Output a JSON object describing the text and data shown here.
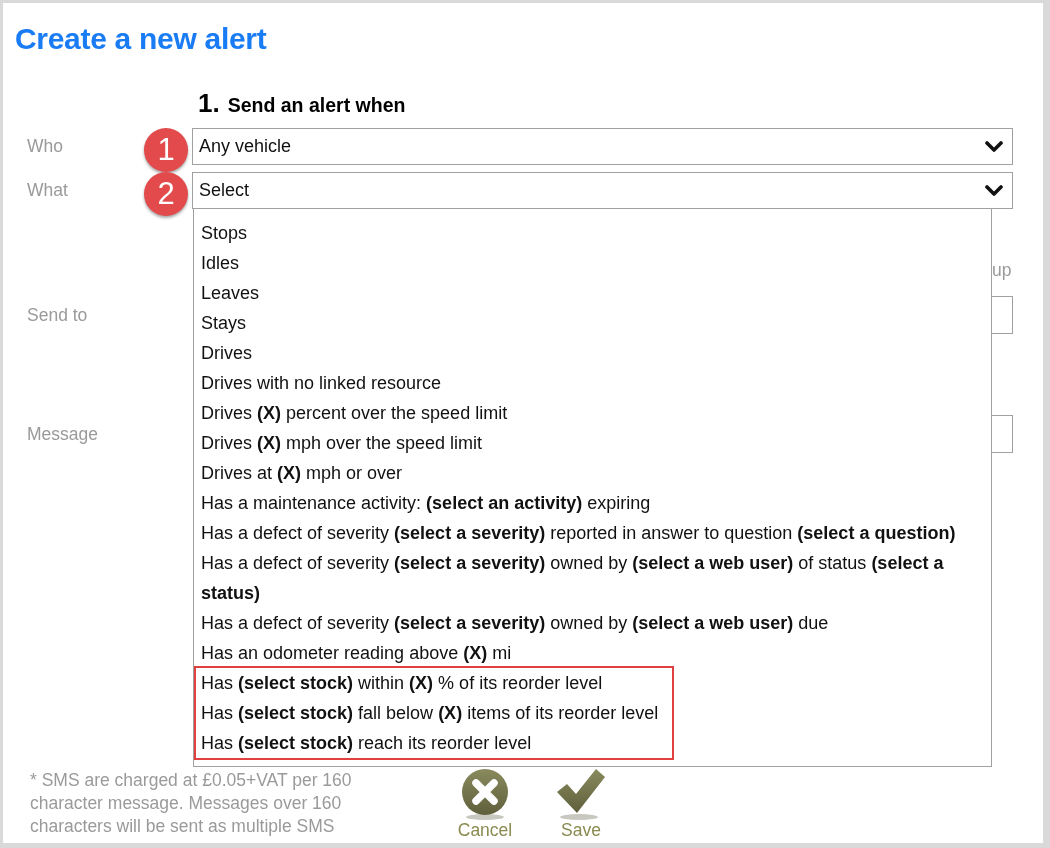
{
  "title": "Create a new alert",
  "step": {
    "number": "1.",
    "heading": "Send an alert when"
  },
  "rows": [
    {
      "kind": "select",
      "label": "Who",
      "badge": "1",
      "value": "Any vehicle"
    },
    {
      "kind": "select",
      "label": "What",
      "badge": "2",
      "value": "Select",
      "expanded": true,
      "options": [
        {
          "text": "Stops",
          "highlighted": false
        },
        {
          "text": "Idles",
          "highlighted": false
        },
        {
          "text": "Leaves",
          "highlighted": false
        },
        {
          "text": "Stays",
          "highlighted": false
        },
        {
          "text": "Drives",
          "highlighted": false
        },
        {
          "text": "Drives with no linked resource",
          "highlighted": false
        },
        {
          "text": "Drives **(X)** percent over the speed limit",
          "highlighted": false
        },
        {
          "text": "Drives **(X)** mph over the speed limit",
          "highlighted": false
        },
        {
          "text": "Drives at **(X)** mph or over",
          "highlighted": false
        },
        {
          "text": "Has a maintenance activity: **(select an activity)** expiring",
          "highlighted": false
        },
        {
          "text": "Has a defect of severity **(select a severity)** reported in answer to question **(select a question)**",
          "highlighted": false
        },
        {
          "text": "Has a defect of severity **(select a severity)** owned by **(select a web user)** of status **(select a status)**",
          "highlighted": false
        },
        {
          "text": "Has a defect of severity **(select a severity)** owned by **(select a web user)** due",
          "highlighted": false
        },
        {
          "text": "Has an odometer reading above **(X)** mi",
          "highlighted": false
        },
        {
          "text": "Has **(select stock)** within **(X)** % of its reorder level",
          "highlighted": true
        },
        {
          "text": "Has **(select stock)** fall below **(X)** items of its reorder level",
          "highlighted": true
        },
        {
          "text": "Has **(select stock)** reach its reorder level",
          "highlighted": true
        }
      ]
    },
    {
      "kind": "note",
      "text": "up"
    },
    {
      "kind": "input",
      "label": "Send to"
    },
    {
      "kind": "input",
      "label": "Message"
    }
  ],
  "sms_note": "* SMS are charged at £0.05+VAT per 160 character message. Messages over 160 characters will be sent as multiple SMS",
  "buttons": [
    {
      "kind": "cancel",
      "label": "Cancel"
    },
    {
      "kind": "save",
      "label": "Save"
    }
  ]
}
